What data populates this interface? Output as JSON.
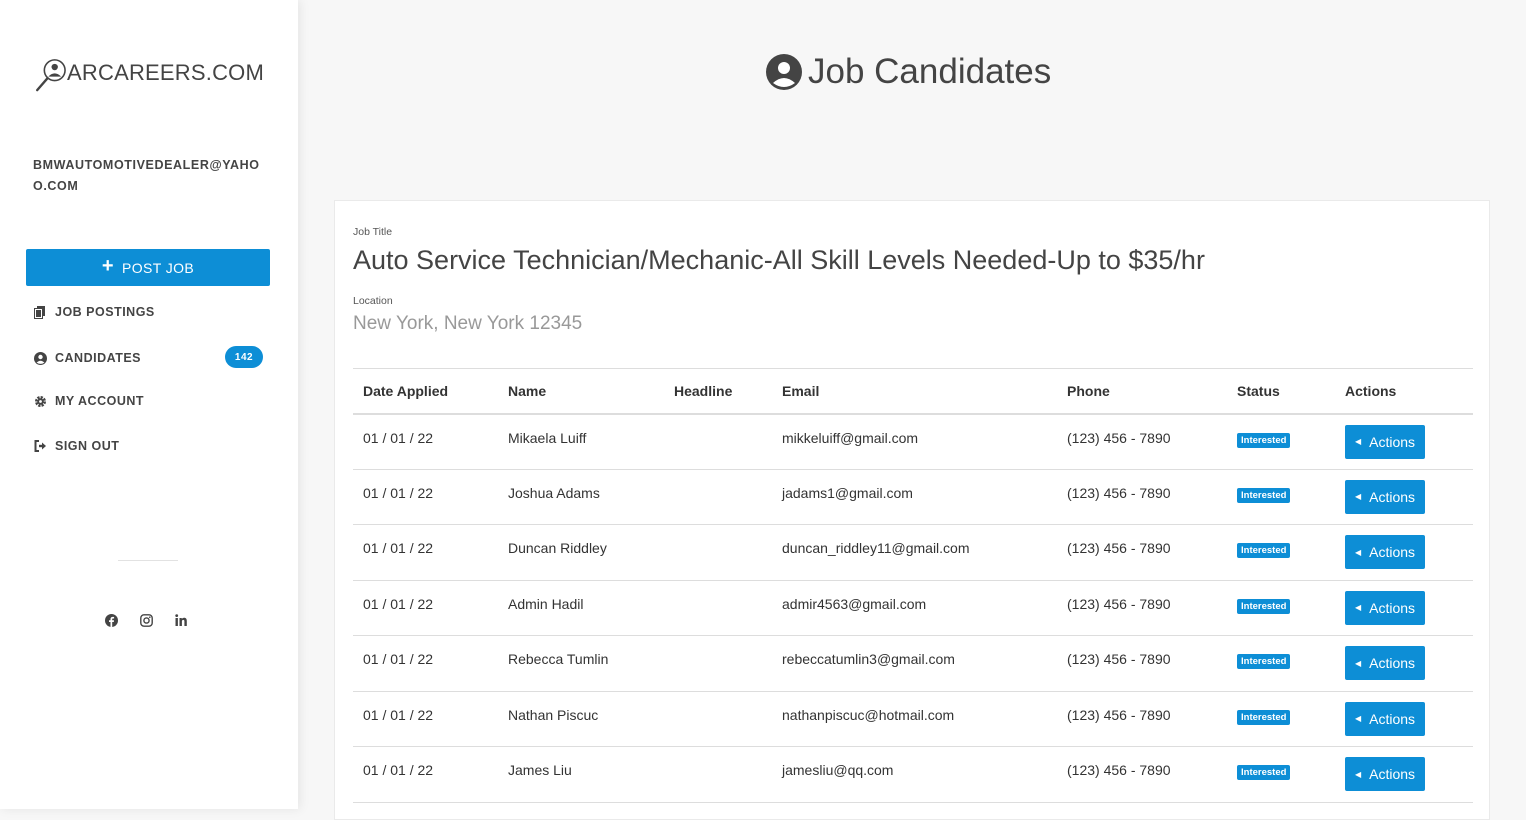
{
  "sidebar": {
    "logo_text": "ARCAREERS.COM",
    "account_email": "BMWAUTOMOTIVEDEALER@YAHOO.COM",
    "post_job_label": "POST JOB",
    "nav": [
      {
        "label": "JOB POSTINGS",
        "icon": "copy-icon"
      },
      {
        "label": "CANDIDATES",
        "icon": "user-circle-icon",
        "badge": "142"
      },
      {
        "label": "MY ACCOUNT",
        "icon": "gear-icon"
      },
      {
        "label": "SIGN OUT",
        "icon": "sign-out-icon"
      }
    ],
    "socials": [
      "facebook-icon",
      "instagram-icon",
      "linkedin-icon"
    ]
  },
  "header": {
    "title": "Job Candidates",
    "icon": "user-circle-icon"
  },
  "job": {
    "title_label": "Job Title",
    "title": "Auto Service Technician/Mechanic-All Skill Levels Needed-Up to $35/hr",
    "location_label": "Location",
    "location": "New York, New York 12345"
  },
  "table": {
    "columns": [
      "Date Applied",
      "Name",
      "Headline",
      "Email",
      "Phone",
      "Status",
      "Actions"
    ],
    "rows": [
      {
        "date": "01 / 01 / 22",
        "name": "Mikaela Luiff",
        "headline": "",
        "email": "mikkeluiff@gmail.com",
        "phone": "(123) 456 - 7890",
        "status": "Interested",
        "action": "Actions"
      },
      {
        "date": "01 / 01 / 22",
        "name": "Joshua Adams",
        "headline": "",
        "email": "jadams1@gmail.com",
        "phone": "(123) 456 - 7890",
        "status": "Interested",
        "action": "Actions"
      },
      {
        "date": "01 / 01 / 22",
        "name": "Duncan Riddley",
        "headline": "",
        "email": "duncan_riddley11@gmail.com",
        "phone": "(123) 456 - 7890",
        "status": "Interested",
        "action": "Actions"
      },
      {
        "date": "01 / 01 / 22",
        "name": "Admin Hadil",
        "headline": "",
        "email": "admir4563@gmail.com",
        "phone": "(123) 456 - 7890",
        "status": "Interested",
        "action": "Actions"
      },
      {
        "date": "01 / 01 / 22",
        "name": "Rebecca Tumlin",
        "headline": "",
        "email": "rebeccatumlin3@gmail.com",
        "phone": "(123) 456 - 7890",
        "status": "Interested",
        "action": "Actions"
      },
      {
        "date": "01 / 01 / 22",
        "name": "Nathan Piscuc",
        "headline": "",
        "email": "nathanpiscuc@hotmail.com",
        "phone": "(123) 456 - 7890",
        "status": "Interested",
        "action": "Actions"
      },
      {
        "date": "01 / 01 / 22",
        "name": "James Liu",
        "headline": "",
        "email": "jamesliu@qq.com",
        "phone": "(123) 456 - 7890",
        "status": "Interested",
        "action": "Actions"
      }
    ]
  },
  "colors": {
    "accent": "#0d8ed6",
    "text": "#444444",
    "muted": "#999999"
  }
}
